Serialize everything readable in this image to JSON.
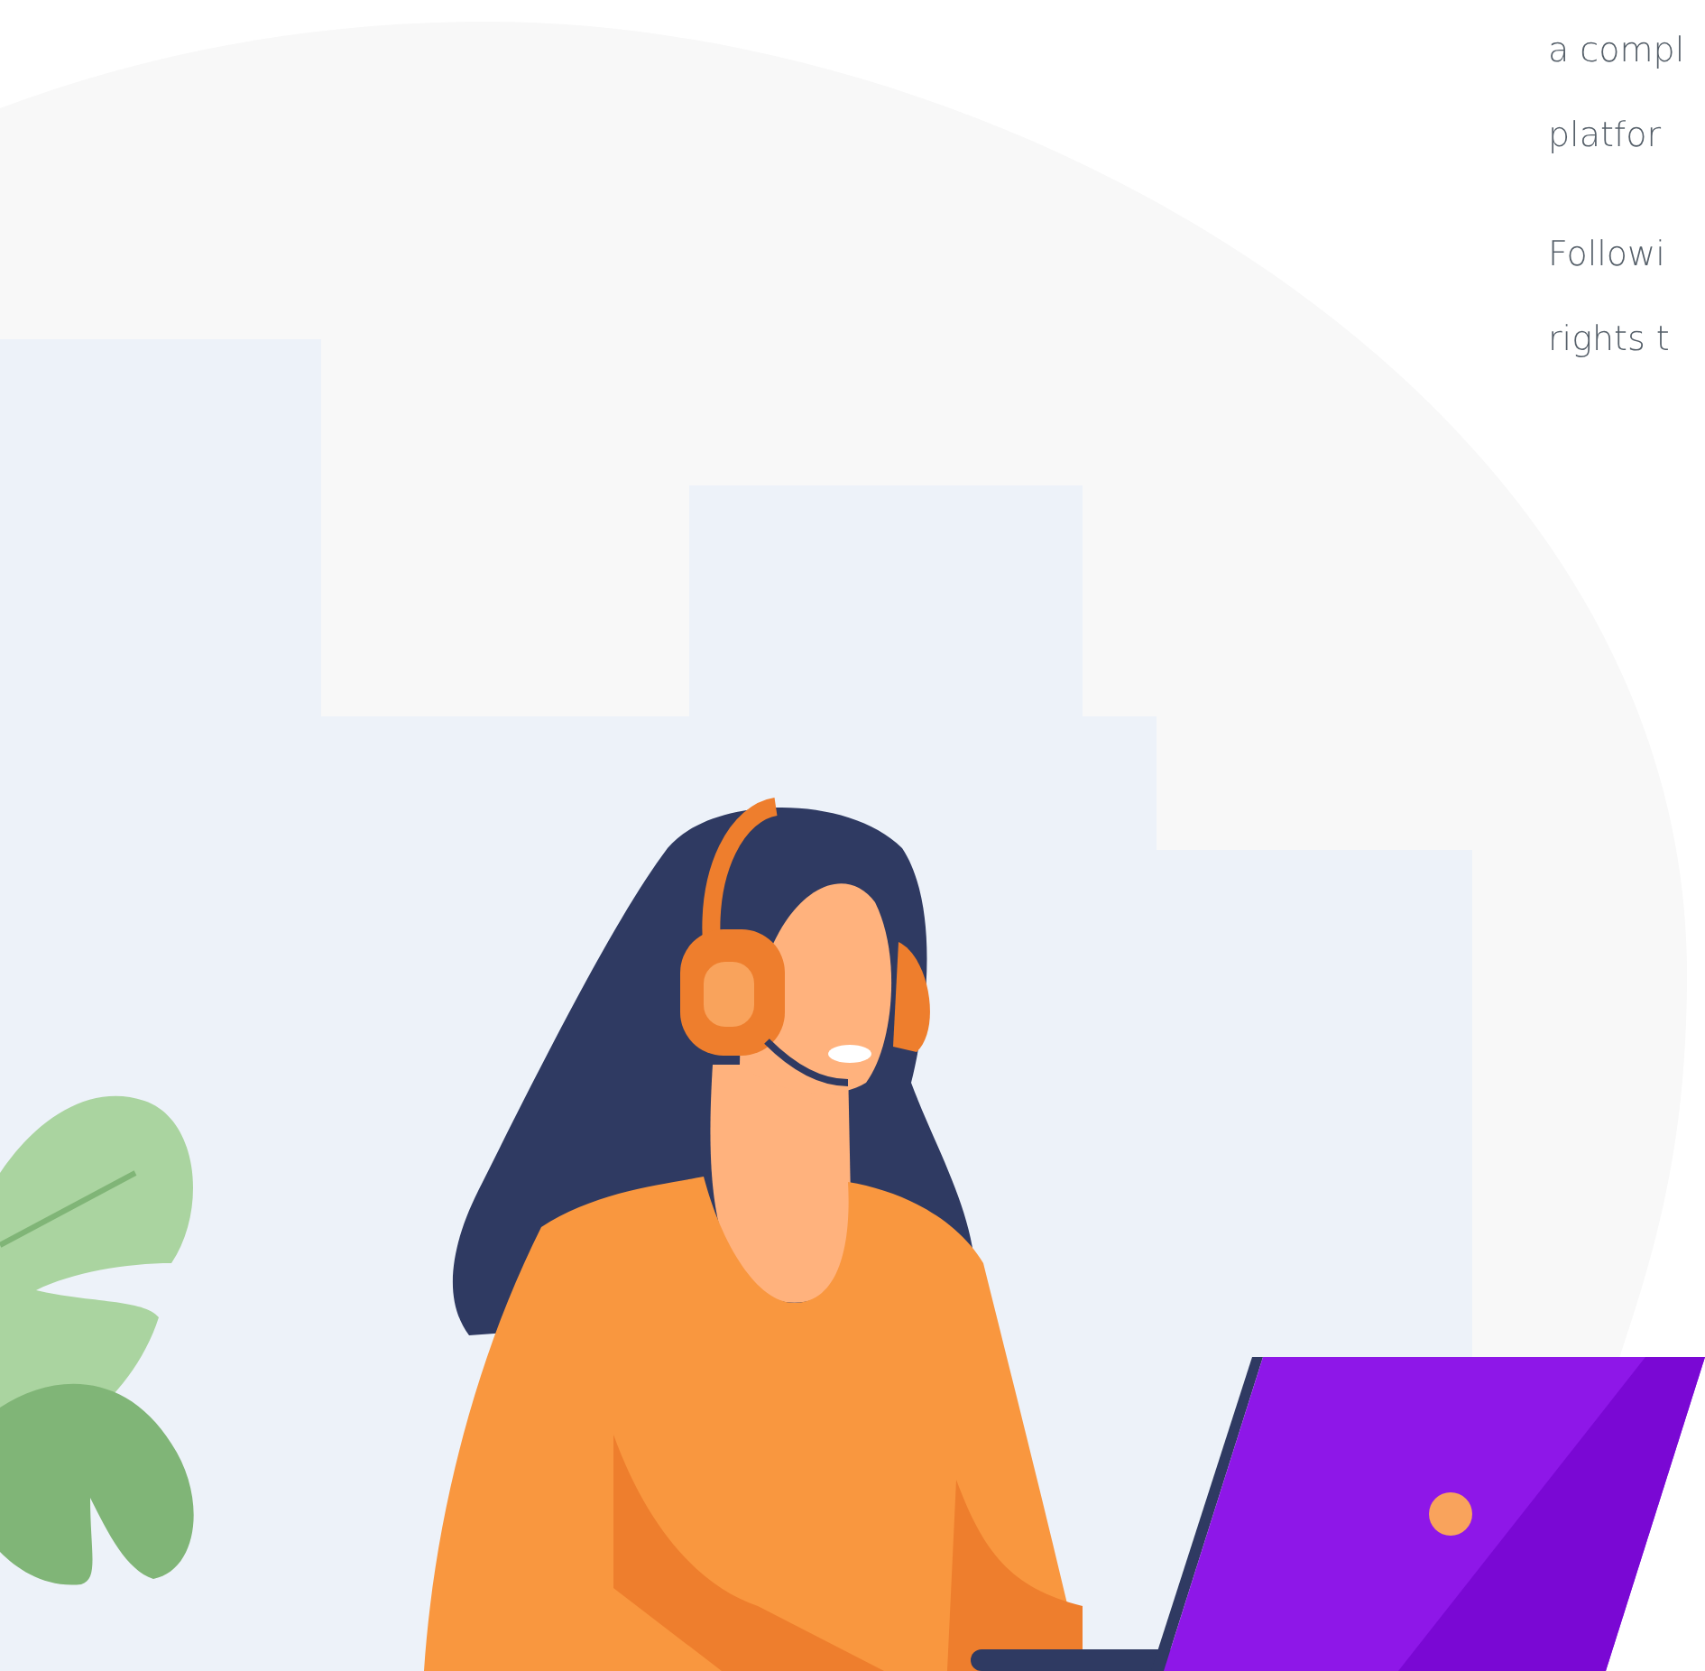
{
  "paragraphs": [
    {
      "lines": [
        "a compl",
        "platfor"
      ]
    },
    {
      "lines": [
        "Followi",
        "rights t"
      ]
    }
  ]
}
